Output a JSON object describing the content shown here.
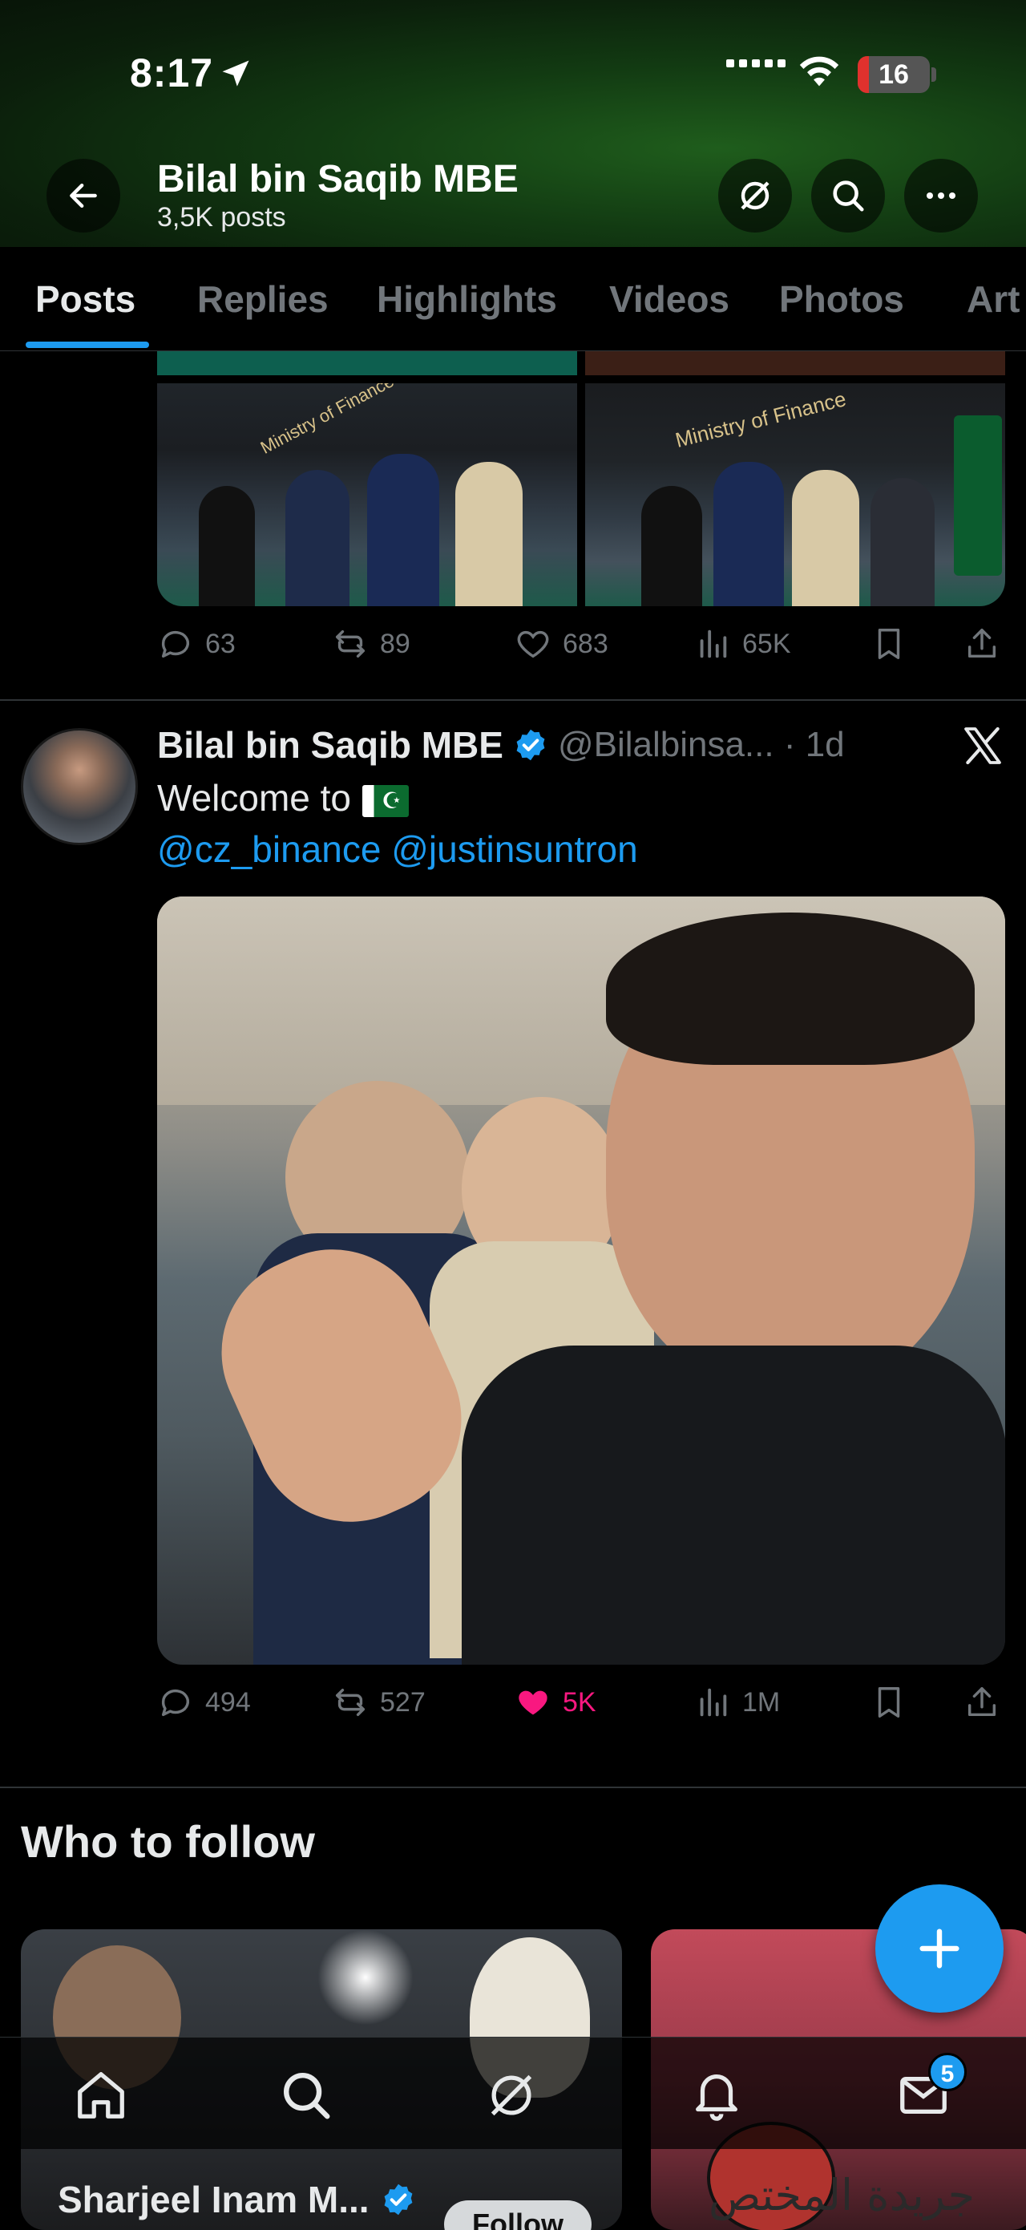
{
  "status_bar": {
    "time": "8:17",
    "battery": "16"
  },
  "header": {
    "profile_name": "Bilal bin Saqib MBE",
    "posts_count": "3,5K posts"
  },
  "tabs": [
    {
      "label": "Posts",
      "active": true
    },
    {
      "label": "Replies"
    },
    {
      "label": "Highlights"
    },
    {
      "label": "Videos"
    },
    {
      "label": "Photos"
    },
    {
      "label": "Art"
    }
  ],
  "post1": {
    "photo_right_text": "Ministry of Finance",
    "photo_left_text": "Ministry of Finance",
    "replies": "63",
    "reposts": "89",
    "likes": "683",
    "views": "65K"
  },
  "post2": {
    "author_name": "Bilal bin Saqib MBE",
    "handle_time": "@Bilalbinsa... · 1d",
    "text": "Welcome to",
    "mentions": "@cz_binance @justinsuntron",
    "replies": "494",
    "reposts": "527",
    "likes": "5K",
    "views": "1M"
  },
  "who_to_follow": {
    "title": "Who to follow",
    "card1_name": "Sharjeel Inam M...",
    "follow_label": "Follow",
    "card2_caption": "جريدة المختص"
  },
  "nav": {
    "messages_badge": "5"
  },
  "colors": {
    "accent": "#1d9bf0",
    "like": "#f91880",
    "bg": "#000000",
    "muted": "#71767b"
  }
}
